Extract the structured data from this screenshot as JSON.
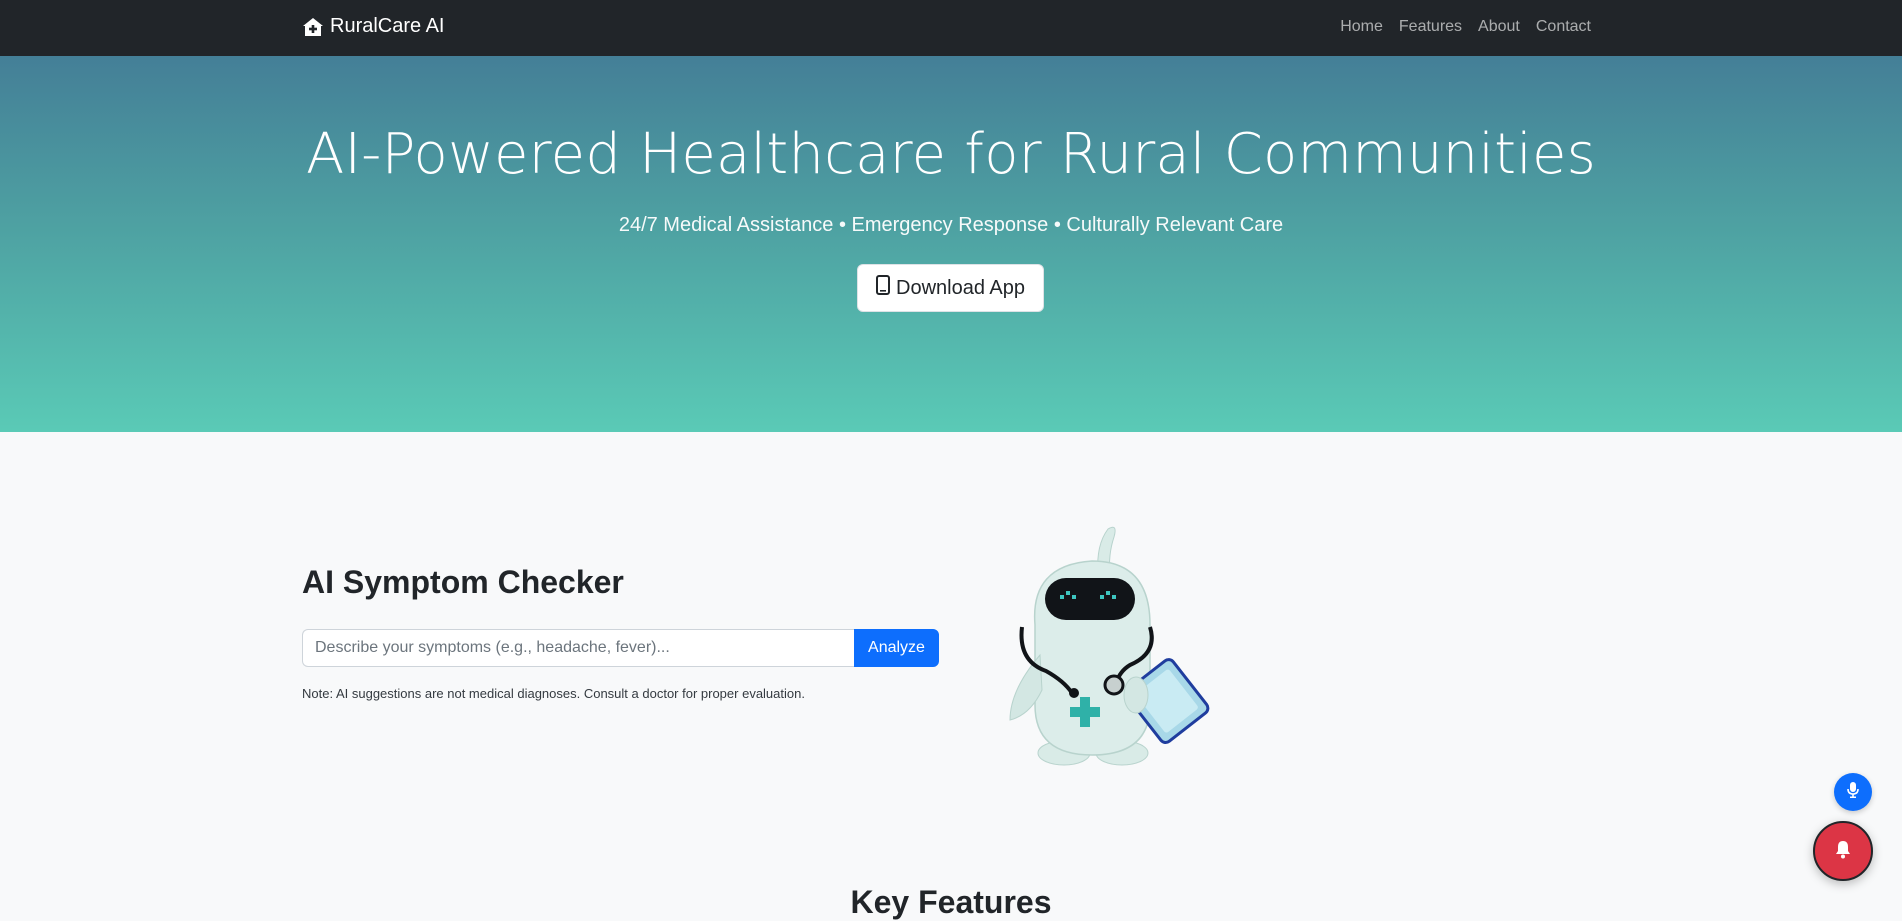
{
  "navbar": {
    "brand": "RuralCare AI",
    "brand_icon": "house-medical-icon",
    "links": [
      "Home",
      "Features",
      "About",
      "Contact"
    ]
  },
  "hero": {
    "title": "AI-Powered Healthcare for Rural Communities",
    "subtitle": "24/7 Medical Assistance • Emergency Response • Culturally Relevant Care",
    "download_label": "Download App",
    "download_icon": "phone-icon"
  },
  "checker": {
    "title": "AI Symptom Checker",
    "placeholder": "Describe your symptoms (e.g., headache, fever)...",
    "analyze_label": "Analyze",
    "note": "Note: AI suggestions are not medical diagnoses. Consult a doctor for proper evaluation."
  },
  "features": {
    "title": "Key Features"
  },
  "floating": {
    "mic_icon": "microphone-icon",
    "emergency_icon": "bell-icon"
  },
  "colors": {
    "navbar": "#212529",
    "hero_top": "#447f97",
    "hero_bottom": "#5acab6",
    "primary": "#0d6efd",
    "danger": "#dc3545"
  }
}
